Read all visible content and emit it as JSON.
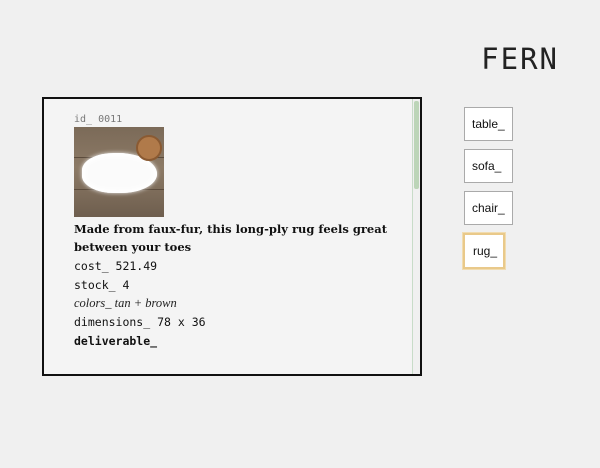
{
  "brand": "FERN",
  "product": {
    "id": "id_ 0011",
    "image_alt": "white faux-fur rug on wooden floor",
    "description": "Made from faux-fur, this long-ply rug feels great between your toes",
    "cost": "cost_ 521.49",
    "stock": "stock_ 4",
    "colors": "colors_ tan + brown",
    "dimensions": "dimensions_ 78 x 36",
    "deliverable": "deliverable_"
  },
  "nav": {
    "items": [
      {
        "label": "table_",
        "active": false
      },
      {
        "label": "sofa_",
        "active": false
      },
      {
        "label": "chair_",
        "active": false
      },
      {
        "label": "rug_",
        "active": true
      }
    ]
  },
  "colors": {
    "active_border": "#e9c98a",
    "scroll_thumb": "#bcd5b8",
    "card_border": "#111111"
  }
}
